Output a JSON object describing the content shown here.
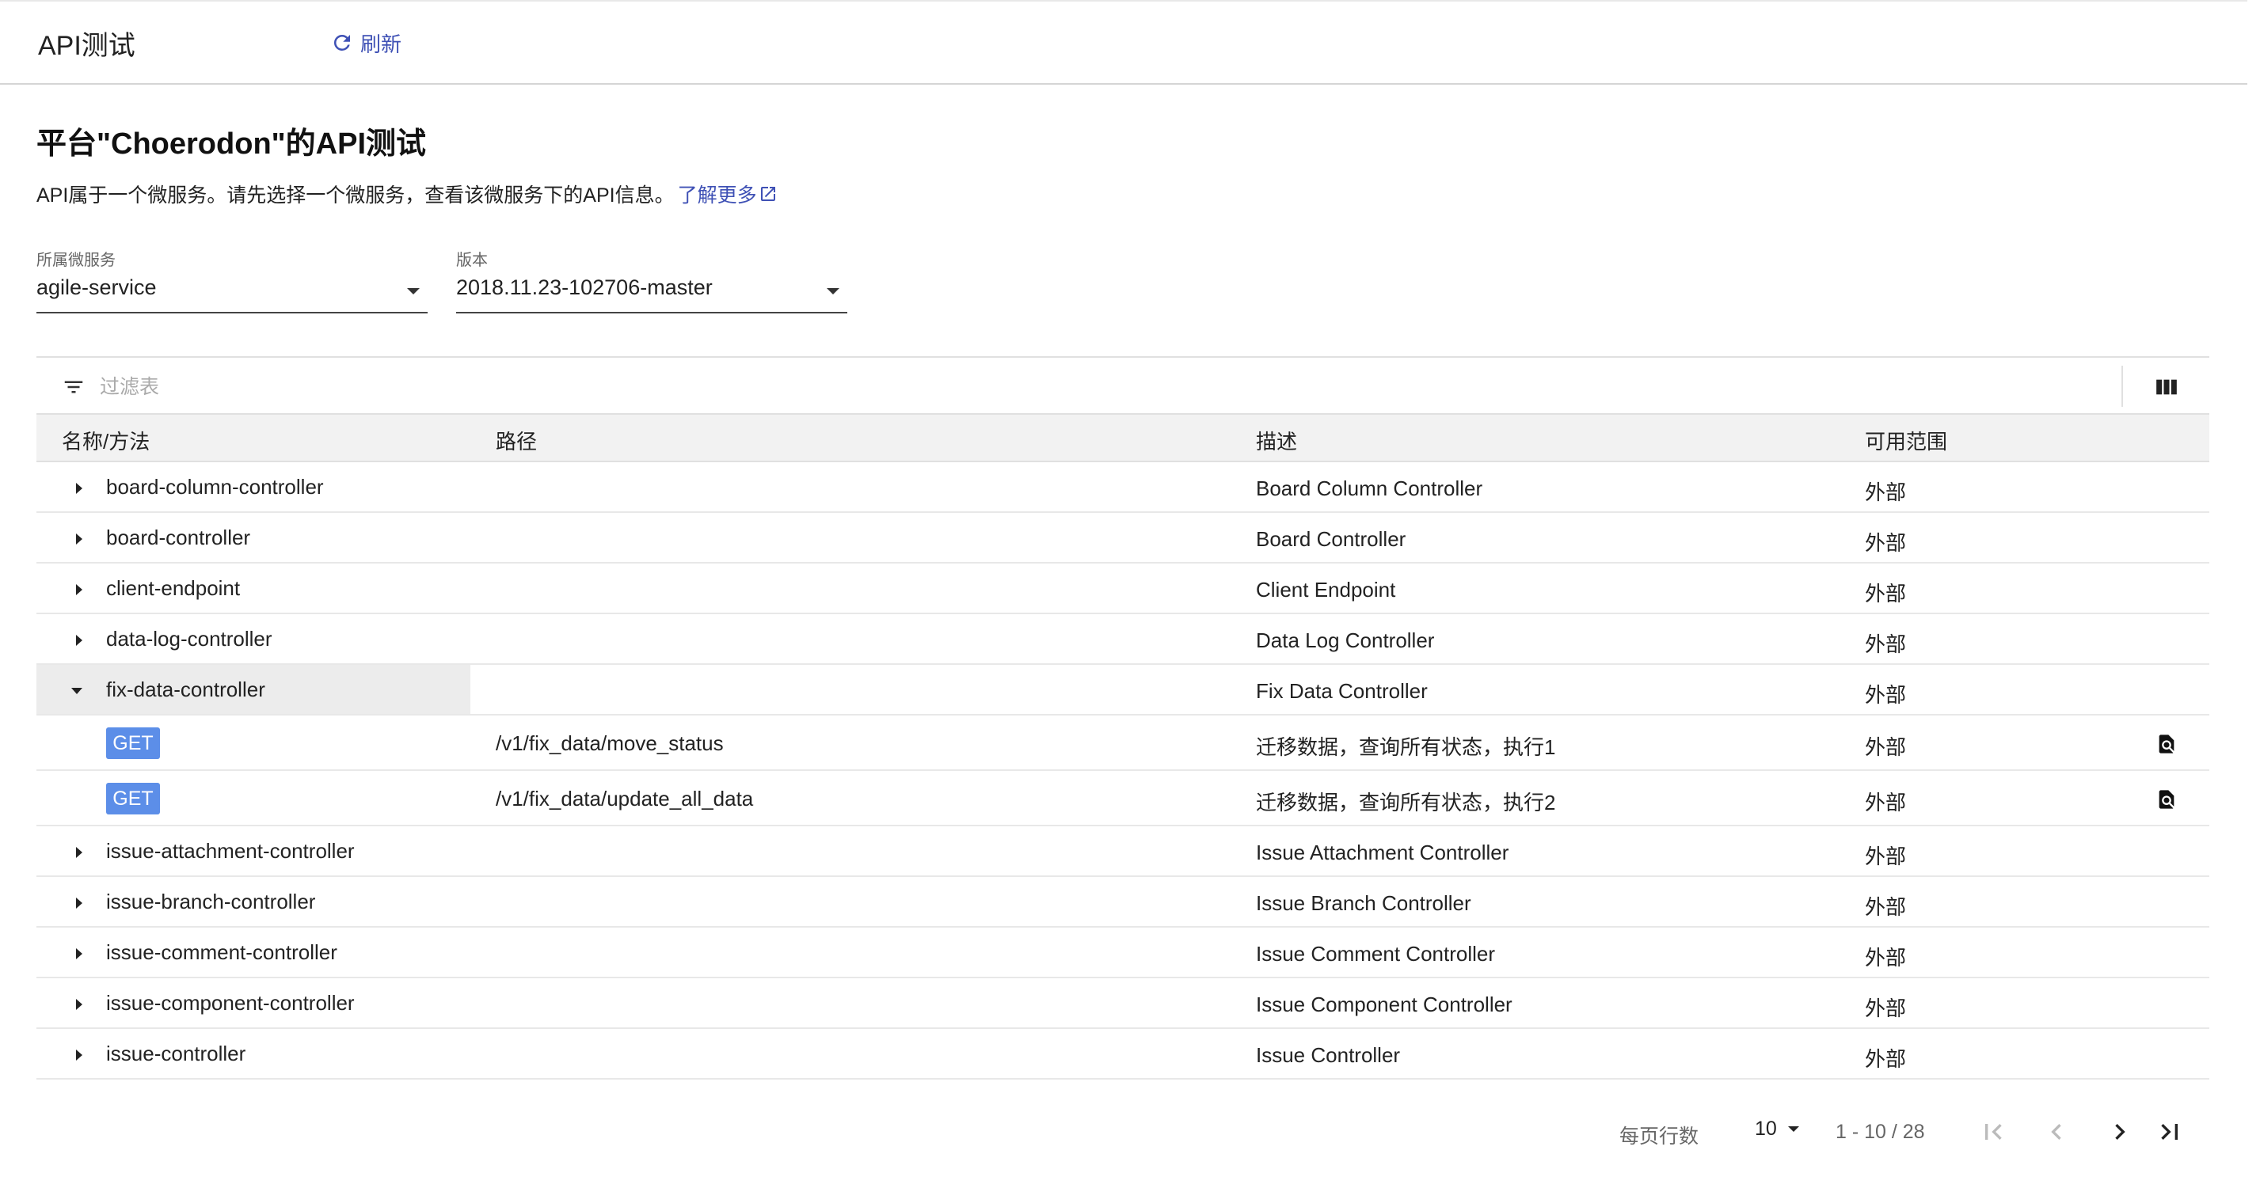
{
  "header": {
    "page_name": "API测试",
    "refresh_label": "刷新"
  },
  "main": {
    "title": "平台\"Choerodon\"的API测试",
    "description": "API属于一个微服务。请先选择一个微服务，查看该微服务下的API信息。",
    "learn_more": "了解更多"
  },
  "filters": {
    "service": {
      "label": "所属微服务",
      "value": "agile-service"
    },
    "version": {
      "label": "版本",
      "value": "2018.11.23-102706-master"
    }
  },
  "table": {
    "filter_placeholder": "过滤表",
    "columns": [
      "名称/方法",
      "路径",
      "描述",
      "可用范围"
    ],
    "rows": [
      {
        "name": "board-column-controller",
        "desc": "Board Column Controller",
        "scope": "外部"
      },
      {
        "name": "board-controller",
        "desc": "Board Controller",
        "scope": "外部"
      },
      {
        "name": "client-endpoint",
        "desc": "Client Endpoint",
        "scope": "外部"
      },
      {
        "name": "data-log-controller",
        "desc": "Data Log Controller",
        "scope": "外部"
      },
      {
        "name": "fix-data-controller",
        "desc": "Fix Data Controller",
        "scope": "外部"
      },
      {
        "name": "issue-attachment-controller",
        "desc": "Issue Attachment Controller",
        "scope": "外部"
      },
      {
        "name": "issue-branch-controller",
        "desc": "Issue Branch Controller",
        "scope": "外部"
      },
      {
        "name": "issue-comment-controller",
        "desc": "Issue Comment Controller",
        "scope": "外部"
      },
      {
        "name": "issue-component-controller",
        "desc": "Issue Component Controller",
        "scope": "外部"
      },
      {
        "name": "issue-controller",
        "desc": "Issue Controller",
        "scope": "外部"
      }
    ],
    "methods": [
      {
        "method": "GET",
        "path": "/v1/fix_data/move_status",
        "desc": "迁移数据，查询所有状态，执行1",
        "scope": "外部"
      },
      {
        "method": "GET",
        "path": "/v1/fix_data/update_all_data",
        "desc": "迁移数据，查询所有状态，执行2",
        "scope": "外部"
      }
    ]
  },
  "pagination": {
    "rows_per_page_label": "每页行数",
    "rows_per_page": "10",
    "range": "1 - 10 / 28"
  },
  "icons": {
    "refresh": "refresh-icon",
    "external": "open-in-new-icon",
    "filter": "filter-list-icon",
    "columns": "view-column-icon",
    "detail": "find-in-page-icon"
  },
  "colors": {
    "accent": "#3f51b5",
    "get_badge": "#5c8ee8",
    "header_bg": "#f2f2f2",
    "expanded_bg": "#ececec"
  }
}
